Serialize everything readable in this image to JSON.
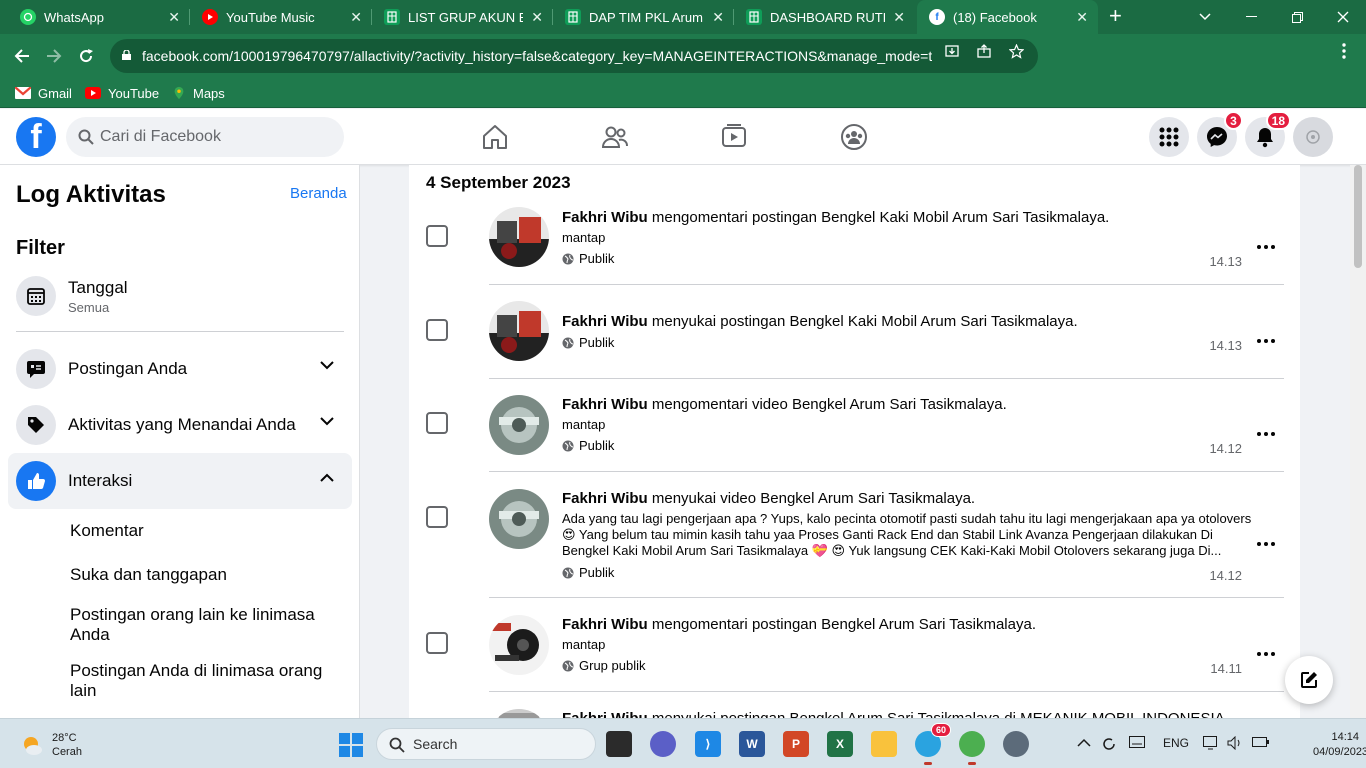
{
  "browser": {
    "tabs": [
      {
        "title": "WhatsApp",
        "icon": "whatsapp-icon",
        "color": "#25d366"
      },
      {
        "title": "YouTube Music",
        "icon": "youtube-music-icon",
        "color": "#ff0000"
      },
      {
        "title": "LIST GRUP AKUN BEN",
        "icon": "sheets-icon",
        "color": "#0f9d58"
      },
      {
        "title": "DAP TIM PKL Arum Sa",
        "icon": "sheets-icon",
        "color": "#0f9d58"
      },
      {
        "title": "DASHBOARD RUTINIT",
        "icon": "sheets-icon",
        "color": "#0f9d58"
      },
      {
        "title": "(18) Facebook",
        "icon": "facebook-icon",
        "color": "#1877f2",
        "active": true
      }
    ],
    "url": "facebook.com/100019796470797/allactivity/?activity_history=false&category_key=MANAGEINTERACTIONS&manage_mode=t...",
    "bookmarks": [
      {
        "label": "Gmail",
        "icon": "gmail-icon"
      },
      {
        "label": "YouTube",
        "icon": "youtube-icon"
      },
      {
        "label": "Maps",
        "icon": "maps-icon"
      }
    ],
    "theme_color": "#1f7a4c"
  },
  "facebook": {
    "search_placeholder": "Cari di Facebook",
    "messenger_badge": "3",
    "notifications_badge": "18",
    "brand_color": "#1877f2"
  },
  "sidebar": {
    "title": "Log Aktivitas",
    "home_link": "Beranda",
    "filter_heading": "Filter",
    "date_filter": {
      "label": "Tanggal",
      "value": "Semua"
    },
    "sections": [
      {
        "label": "Postingan Anda",
        "icon": "speech-bubble-icon"
      },
      {
        "label": "Aktivitas yang Menandai Anda",
        "icon": "tag-icon"
      },
      {
        "label": "Interaksi",
        "icon": "thumbs-up-icon"
      }
    ],
    "sub_items": [
      "Komentar",
      "Suka dan tanggapan",
      "Postingan orang lain ke linimasa Anda",
      "Postingan Anda di linimasa orang lain"
    ]
  },
  "feed": {
    "date_heading": "4 September 2023",
    "items": [
      {
        "actor": "Fakhri Wibu",
        "verb": "mengomentari",
        "object": "postingan Bengkel Kaki Mobil Arum Sari Tasikmalaya.",
        "comment": "mantap",
        "privacy": "Publik",
        "time": "14.13"
      },
      {
        "actor": "Fakhri Wibu",
        "verb": "menyukai",
        "object": "postingan Bengkel Kaki Mobil Arum Sari Tasikmalaya.",
        "comment": "",
        "privacy": "Publik",
        "time": "14.13"
      },
      {
        "actor": "Fakhri Wibu",
        "verb": "mengomentari",
        "object": "video Bengkel Arum Sari Tasikmalaya.",
        "comment": "mantap",
        "privacy": "Publik",
        "time": "14.12"
      },
      {
        "actor": "Fakhri Wibu",
        "verb": "menyukai",
        "object": "video Bengkel Arum Sari Tasikmalaya.",
        "comment": "Ada yang tau lagi pengerjaan apa ? Yups, kalo pecinta otomotif pasti sudah tahu itu lagi mengerjakaan apa ya otolovers 😍 Yang belum tau mimin kasih tahu yaa Proses Ganti Rack End dan Stabil Link Avanza Pengerjaan dilakukan Di Bengkel Kaki Mobil Arum Sari Tasikmalaya 💝 😍 Yuk langsung CEK Kaki-Kaki Mobil Otolovers sekarang juga Di...",
        "privacy": "Publik",
        "time": "14.12"
      },
      {
        "actor": "Fakhri Wibu",
        "verb": "mengomentari",
        "object": "postingan",
        "object2": "Bengkel Arum Sari Tasikmalaya.",
        "comment": "mantap",
        "privacy": "Grup publik",
        "time": "14.11"
      },
      {
        "actor": "Fakhri Wibu",
        "verb": "menyukai",
        "object": "postingan Bengkel Arum Sari Tasikmalaya di MEKANIK MOBIL INDONESIA",
        "comment": "",
        "privacy": "",
        "time": ""
      }
    ]
  },
  "taskbar": {
    "weather": {
      "temp": "28°C",
      "condition": "Cerah"
    },
    "search_placeholder": "Search",
    "telegram_badge": "60",
    "language": "ENG",
    "time": "14:14",
    "date": "04/09/2023"
  }
}
